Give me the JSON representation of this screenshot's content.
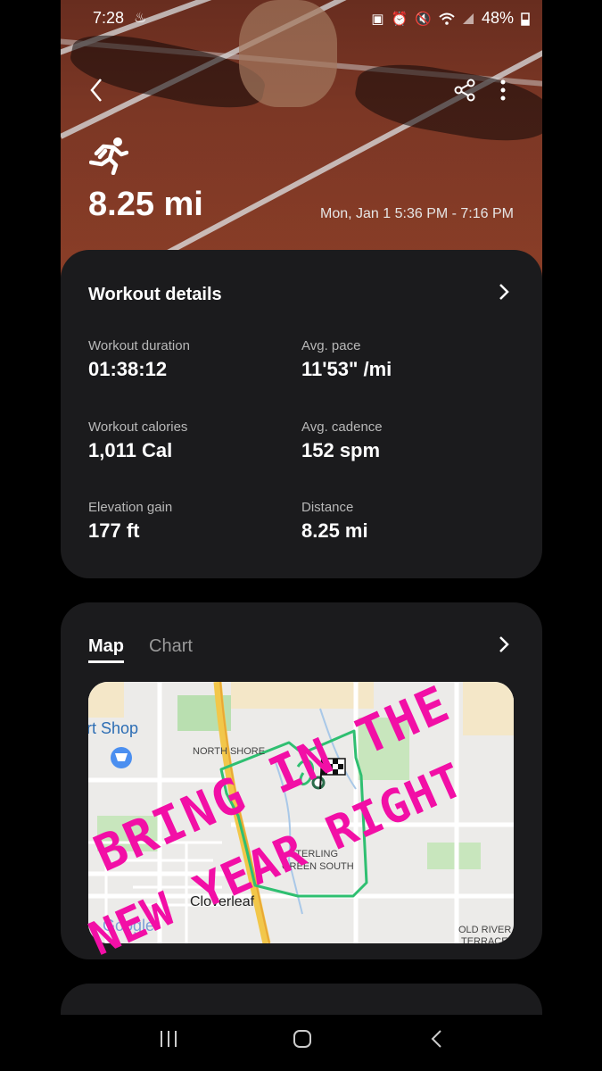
{
  "status": {
    "time": "7:28",
    "battery": "48%"
  },
  "hero": {
    "distance": "8.25 mi",
    "date_range": "Mon, Jan 1 5:36 PM - 7:16 PM"
  },
  "details": {
    "title": "Workout details",
    "stats": [
      {
        "label": "Workout duration",
        "value": "01:38:12"
      },
      {
        "label": "Avg. pace",
        "value": "11'53\" /mi"
      },
      {
        "label": "Workout calories",
        "value": "1,011 Cal"
      },
      {
        "label": "Avg. cadence",
        "value": "152 spm"
      },
      {
        "label": "Elevation gain",
        "value": "177 ft"
      },
      {
        "label": "Distance",
        "value": "8.25 mi"
      }
    ]
  },
  "map_card": {
    "tabs": [
      "Map",
      "Chart"
    ],
    "labels": {
      "shop": "rt Shop",
      "north": "NORTH SHORE",
      "sterling1": "STERLING",
      "sterling2": "GREEN SOUTH",
      "cloverleaf": "Cloverleaf",
      "google": "Google",
      "old1": "OLD RIVER",
      "old2": "TERRACE"
    },
    "overlay": [
      "BRING IN THE",
      "NEW YEAR RIGHT"
    ],
    "colors": {
      "route": "#2fbf71",
      "overlay": "#f20fa6"
    }
  }
}
